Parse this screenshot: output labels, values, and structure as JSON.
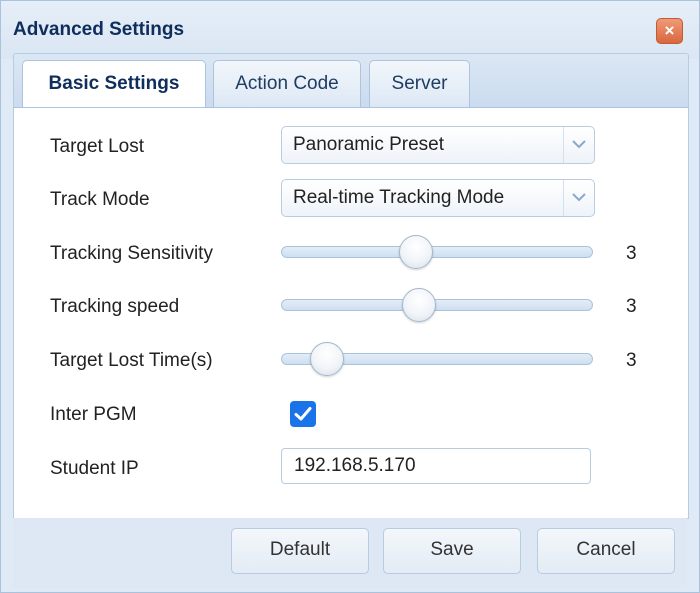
{
  "dialog": {
    "title": "Advanced Settings",
    "close_glyph": "×"
  },
  "tabs": [
    {
      "label": "Basic Settings",
      "active": true
    },
    {
      "label": "Action Code",
      "active": false
    },
    {
      "label": "Server",
      "active": false
    }
  ],
  "form": {
    "target_lost": {
      "label": "Target Lost",
      "value": "Panoramic Preset"
    },
    "track_mode": {
      "label": "Track Mode",
      "value": "Real-time Tracking Mode"
    },
    "tracking_sensitivity": {
      "label": "Tracking Sensitivity",
      "value": "3",
      "fraction": 0.42
    },
    "tracking_speed": {
      "label": "Tracking speed",
      "value": "3",
      "fraction": 0.43
    },
    "target_lost_time": {
      "label": "Target Lost Time(s)",
      "value": "3",
      "fraction": 0.1
    },
    "inter_pgm": {
      "label": "Inter PGM",
      "checked": true
    },
    "student_ip": {
      "label": "Student IP",
      "value": "192.168.5.170"
    }
  },
  "buttons": {
    "default": "Default",
    "save": "Save",
    "cancel": "Cancel"
  },
  "colors": {
    "accent": "#1a73e8",
    "close": "#d9673e"
  },
  "icons": {
    "close": "close-icon",
    "dropdown": "chevron-down-icon",
    "check": "checkmark-icon"
  }
}
